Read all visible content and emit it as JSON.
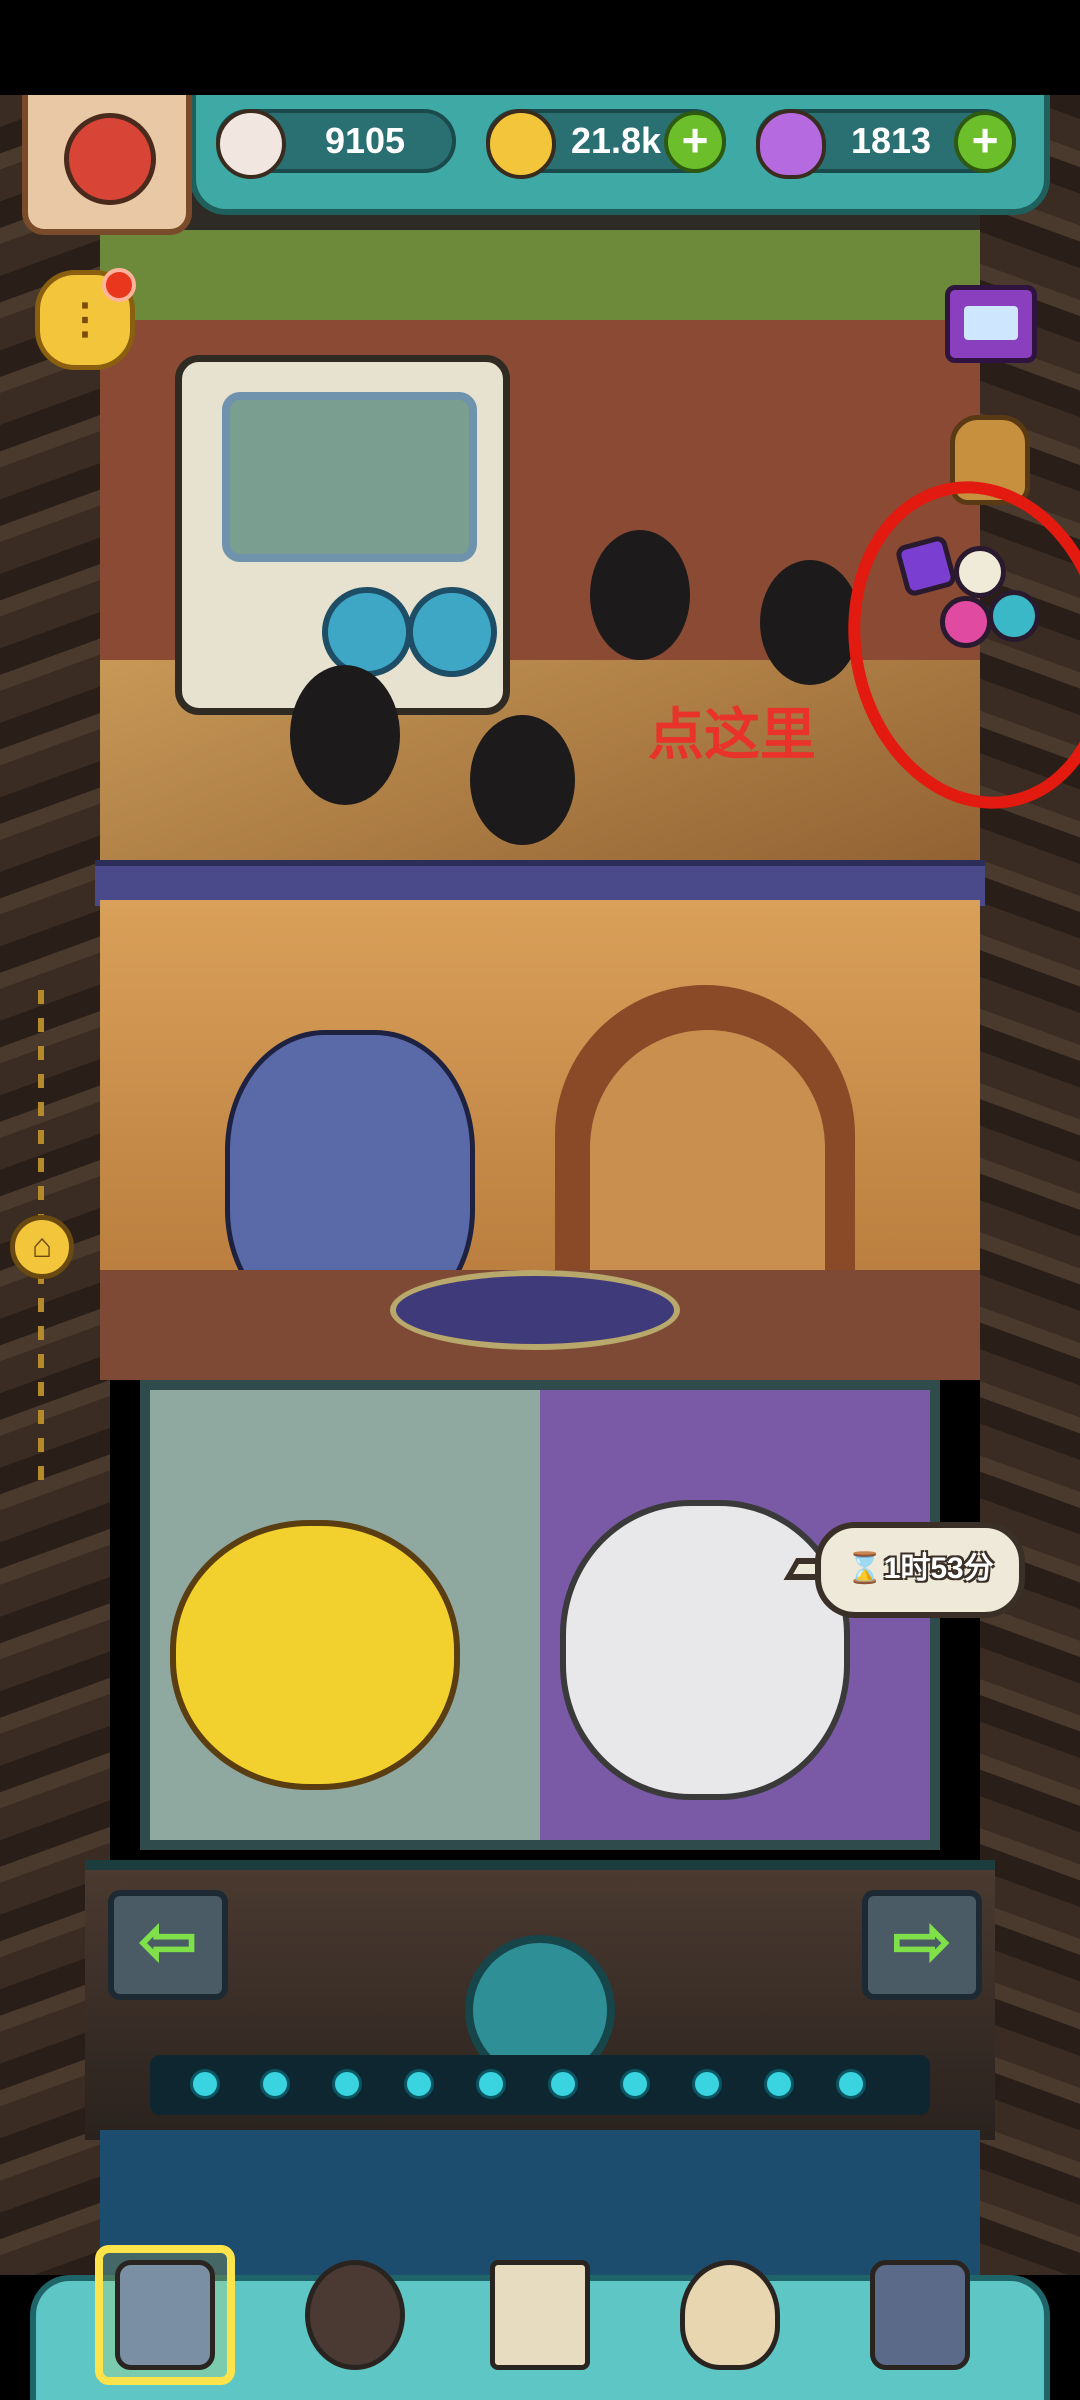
{
  "top_bar": {
    "eyes": {
      "icon": "eyeball-icon",
      "value": "9105"
    },
    "coins": {
      "icon": "gold-coin-icon",
      "value": "21.8k"
    },
    "potions": {
      "icon": "purple-potion-icon",
      "value": "1813"
    },
    "plus_label": "+"
  },
  "annotation": {
    "hint_text": "点这里",
    "circle_color": "#e21a10"
  },
  "timer": {
    "icon": "hourglass-icon",
    "text": "1时53分"
  },
  "side_buttons": {
    "menu_label": "⋮",
    "home_label": "⌂"
  },
  "machine": {
    "left_arrow": "⇦",
    "right_arrow": "⇨"
  },
  "bottom_nav": {
    "tabs": [
      {
        "name": "base-tab",
        "icon": "building-icon",
        "selected": true
      },
      {
        "name": "monster-tab",
        "icon": "fire-monster-icon",
        "selected": false
      },
      {
        "name": "book-tab",
        "icon": "open-book-icon",
        "selected": false
      },
      {
        "name": "shop-tab",
        "icon": "coin-sack-icon",
        "selected": false
      },
      {
        "name": "more-tab",
        "icon": "grid-icon",
        "selected": false
      }
    ]
  },
  "colors": {
    "accent_teal": "#3fa9a5",
    "plus_green": "#6cbf2a",
    "annotation_red": "#e21a10",
    "selection_yellow": "#ffe34a"
  }
}
